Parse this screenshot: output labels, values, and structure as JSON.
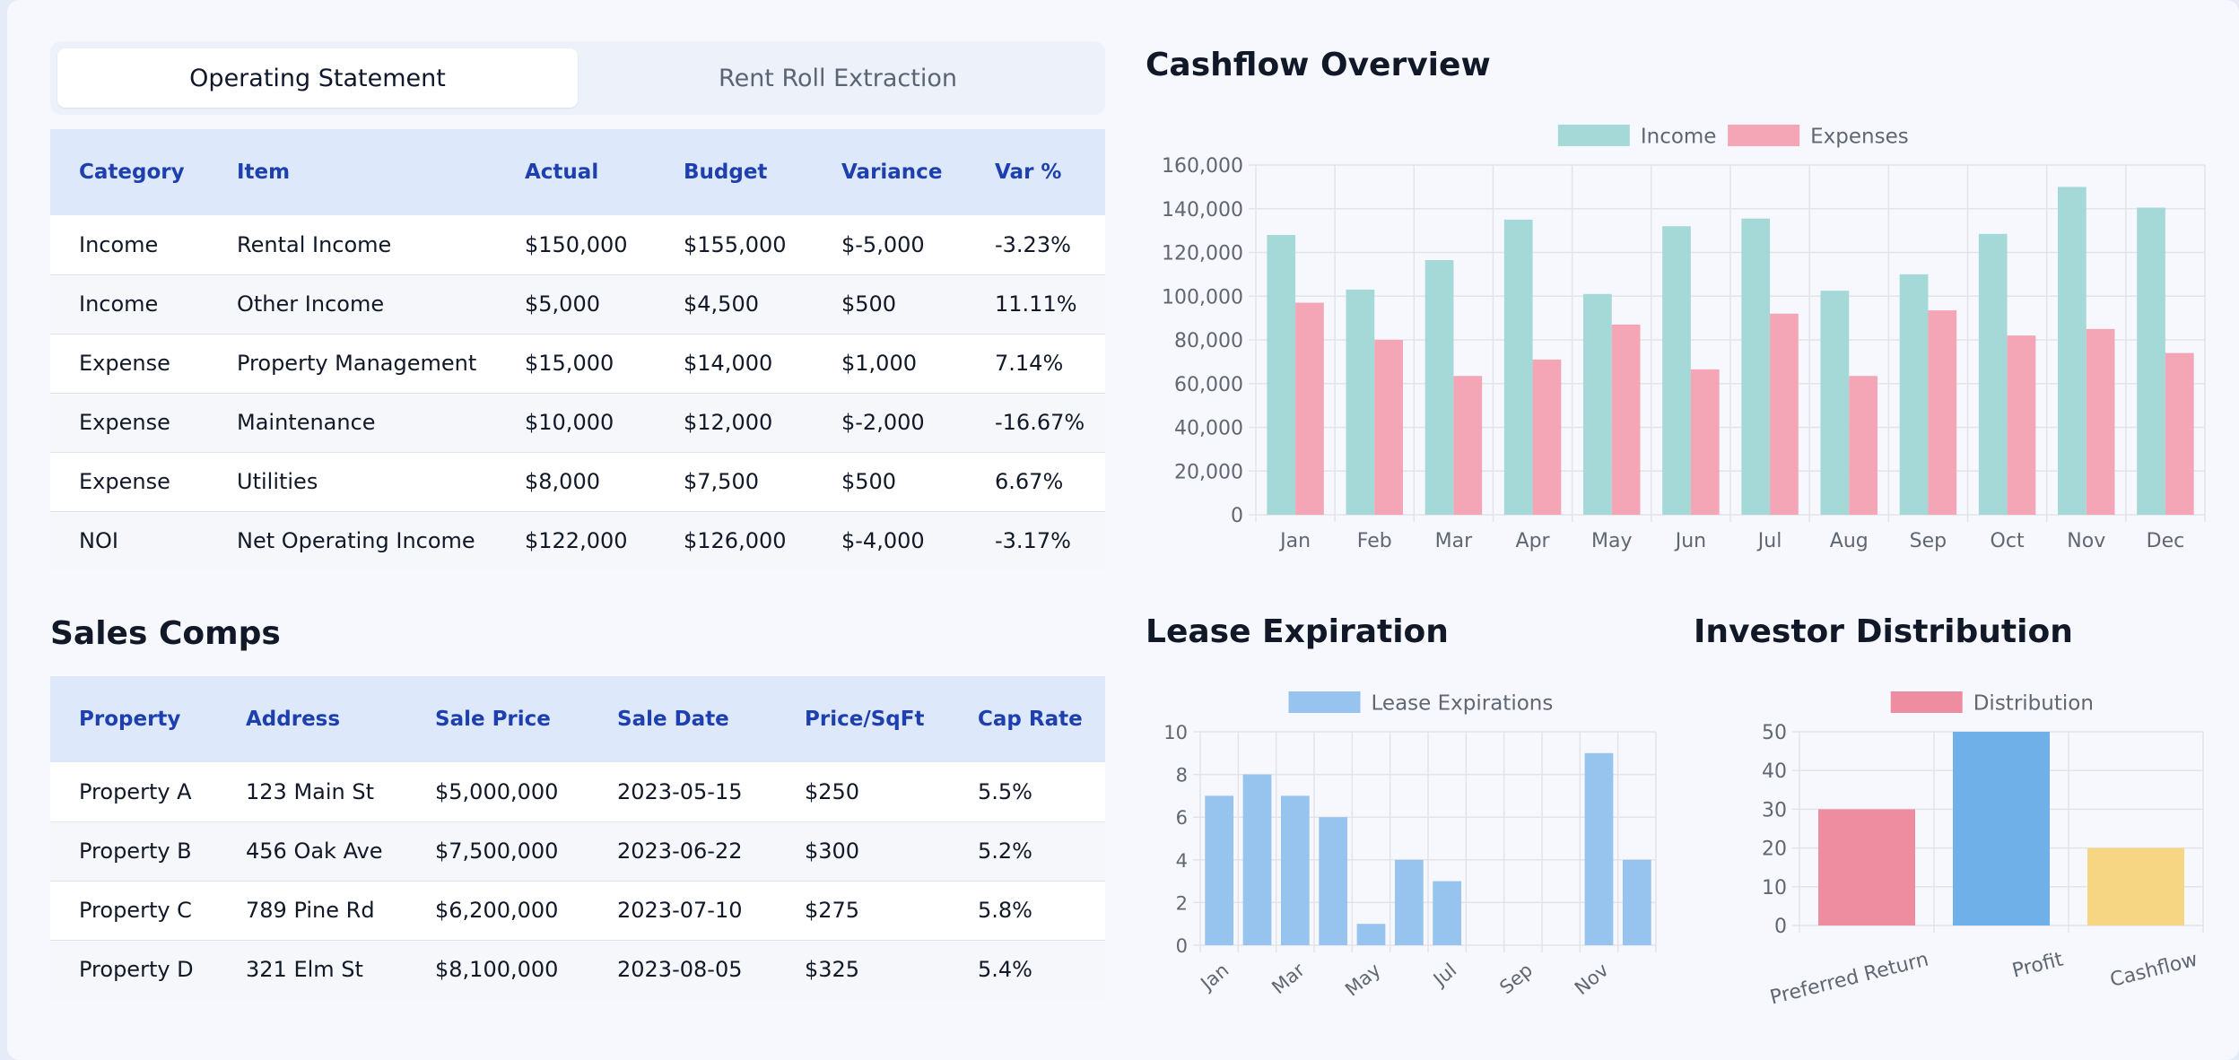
{
  "tabs": [
    {
      "label": "Operating Statement",
      "active": true
    },
    {
      "label": "Rent Roll Extraction",
      "active": false
    }
  ],
  "operating_statement": {
    "headers": [
      "Category",
      "Item",
      "Actual",
      "Budget",
      "Variance",
      "Var %"
    ],
    "rows": [
      [
        "Income",
        "Rental Income",
        "$150,000",
        "$155,000",
        "$-5,000",
        "-3.23%"
      ],
      [
        "Income",
        "Other Income",
        "$5,000",
        "$4,500",
        "$500",
        "11.11%"
      ],
      [
        "Expense",
        "Property Management",
        "$15,000",
        "$14,000",
        "$1,000",
        "7.14%"
      ],
      [
        "Expense",
        "Maintenance",
        "$10,000",
        "$12,000",
        "$-2,000",
        "-16.67%"
      ],
      [
        "Expense",
        "Utilities",
        "$8,000",
        "$7,500",
        "$500",
        "6.67%"
      ],
      [
        "NOI",
        "Net Operating Income",
        "$122,000",
        "$126,000",
        "$-4,000",
        "-3.17%"
      ]
    ]
  },
  "sales_comps": {
    "title": "Sales Comps",
    "headers": [
      "Property",
      "Address",
      "Sale Price",
      "Sale Date",
      "Price/SqFt",
      "Cap Rate"
    ],
    "rows": [
      [
        "Property A",
        "123 Main St",
        "$5,000,000",
        "2023-05-15",
        "$250",
        "5.5%"
      ],
      [
        "Property B",
        "456 Oak Ave",
        "$7,500,000",
        "2023-06-22",
        "$300",
        "5.2%"
      ],
      [
        "Property C",
        "789 Pine Rd",
        "$6,200,000",
        "2023-07-10",
        "$275",
        "5.8%"
      ],
      [
        "Property D",
        "321 Elm St",
        "$8,100,000",
        "2023-08-05",
        "$325",
        "5.4%"
      ]
    ]
  },
  "colors": {
    "income": "#a5d9d8",
    "expenses": "#f4a6b6",
    "lease": "#96c4ee",
    "pref": "#ef8da0",
    "profit": "#6fb0e8",
    "cashflow": "#f6d683",
    "grid": "#e2e4e8",
    "tick": "#606672"
  },
  "chart_data": [
    {
      "type": "bar",
      "title": "Cashflow Overview",
      "categories": [
        "Jan",
        "Feb",
        "Mar",
        "Apr",
        "May",
        "Jun",
        "Jul",
        "Aug",
        "Sep",
        "Oct",
        "Nov",
        "Dec"
      ],
      "series": [
        {
          "name": "Income",
          "values": [
            128000,
            103000,
            116500,
            135000,
            101000,
            132000,
            135500,
            102500,
            110000,
            128500,
            150000,
            140500
          ]
        },
        {
          "name": "Expenses",
          "values": [
            97000,
            80000,
            63500,
            71000,
            87000,
            66500,
            92000,
            63500,
            93500,
            82000,
            85000,
            74000
          ]
        }
      ],
      "ylim": [
        0,
        160000
      ],
      "yticks": [
        "0",
        "20,000",
        "40,000",
        "60,000",
        "80,000",
        "100,000",
        "120,000",
        "140,000",
        "160,000"
      ],
      "legend": "top",
      "grid": true
    },
    {
      "type": "bar",
      "title": "Lease Expiration",
      "categories": [
        "Jan",
        "Feb",
        "Mar",
        "Apr",
        "May",
        "Jun",
        "Jul",
        "Aug",
        "Sep",
        "Oct",
        "Nov",
        "Dec"
      ],
      "xtick_labels": [
        "Jan",
        "",
        "Mar",
        "",
        "May",
        "",
        "Jul",
        "",
        "Sep",
        "",
        "Nov",
        ""
      ],
      "series": [
        {
          "name": "Lease Expirations",
          "values": [
            7,
            8,
            7,
            6,
            1,
            4,
            3,
            0,
            0,
            0,
            9,
            4
          ]
        }
      ],
      "ylim": [
        0,
        10
      ],
      "yticks": [
        "0",
        "2",
        "4",
        "6",
        "8",
        "10"
      ],
      "legend": "top",
      "grid": true
    },
    {
      "type": "bar",
      "title": "Investor Distribution",
      "categories": [
        "Preferred Return",
        "Profit",
        "Cashflow"
      ],
      "series": [
        {
          "name": "Distribution",
          "values": [
            30,
            50,
            20
          ]
        }
      ],
      "ylim": [
        0,
        50
      ],
      "yticks": [
        "0",
        "10",
        "20",
        "30",
        "40",
        "50"
      ],
      "legend": "top",
      "grid": true
    }
  ]
}
